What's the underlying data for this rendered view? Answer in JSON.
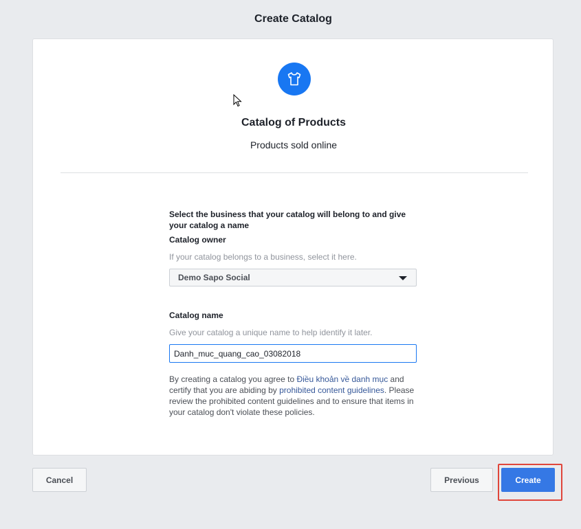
{
  "header": {
    "title": "Create Catalog"
  },
  "catalog_type": {
    "icon": "tshirt-icon",
    "title": "Catalog of Products",
    "subtitle": "Products sold online"
  },
  "form": {
    "heading": "Select the business that your catalog will belong to and give your catalog a name",
    "owner_label": "Catalog owner",
    "owner_help": "If your catalog belongs to a business, select it here.",
    "owner_selected": "Demo Sapo Social",
    "name_label": "Catalog name",
    "name_help": "Give your catalog a unique name to help identify it later.",
    "name_value": "Danh_muc_quang_cao_03082018",
    "terms_prefix": "By creating a catalog you agree to ",
    "terms_link1": "Điều khoản về danh mục",
    "terms_mid": " and certify that you are abiding by ",
    "terms_link2": "prohibited content guidelines",
    "terms_suffix": ". Please review the prohibited content guidelines and to ensure that items in your catalog don't violate these policies."
  },
  "footer": {
    "cancel_label": "Cancel",
    "previous_label": "Previous",
    "create_label": "Create"
  },
  "colors": {
    "accent": "#1877f2",
    "primary_button": "#3578e5",
    "highlight_border": "#e0453a"
  }
}
